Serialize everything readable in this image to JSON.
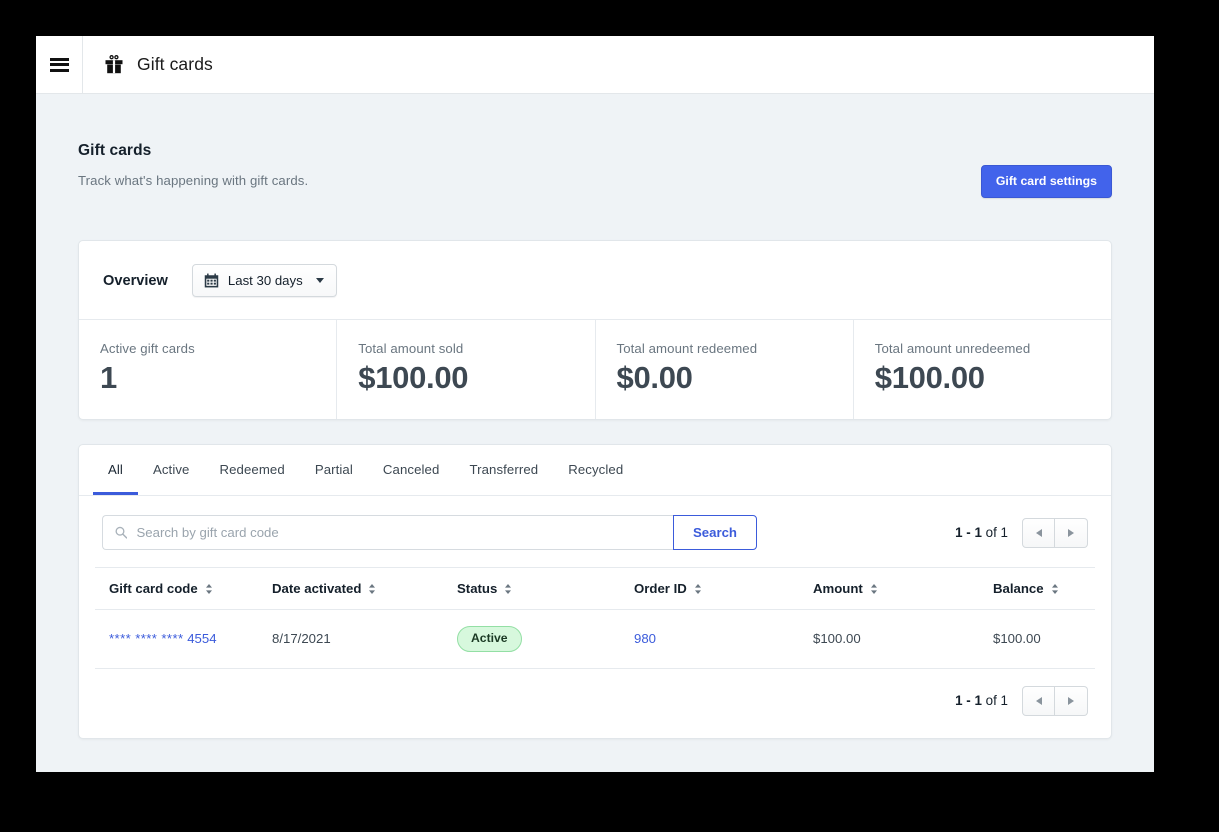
{
  "topbar": {
    "menu_icon": "hamburger-icon",
    "app_icon": "gift-icon",
    "title": "Gift cards"
  },
  "page": {
    "title": "Gift cards",
    "subtitle": "Track what's happening with gift cards.",
    "settings_button": "Gift card settings"
  },
  "overview": {
    "label": "Overview",
    "date_range": "Last 30 days",
    "metrics": [
      {
        "label": "Active gift cards",
        "value": "1"
      },
      {
        "label": "Total amount sold",
        "value": "$100.00"
      },
      {
        "label": "Total amount redeemed",
        "value": "$0.00"
      },
      {
        "label": "Total amount unredeemed",
        "value": "$100.00"
      }
    ]
  },
  "tabs": [
    {
      "label": "All",
      "active": true
    },
    {
      "label": "Active",
      "active": false
    },
    {
      "label": "Redeemed",
      "active": false
    },
    {
      "label": "Partial",
      "active": false
    },
    {
      "label": "Canceled",
      "active": false
    },
    {
      "label": "Transferred",
      "active": false
    },
    {
      "label": "Recycled",
      "active": false
    }
  ],
  "search": {
    "placeholder": "Search by gift card code",
    "value": "",
    "button_label": "Search"
  },
  "pagination": {
    "range": "1 - 1",
    "of_text": "of 1"
  },
  "table": {
    "columns": [
      "Gift card code",
      "Date activated",
      "Status",
      "Order ID",
      "Amount",
      "Balance"
    ],
    "rows": [
      {
        "code_mask": "**** **** ****",
        "code_last4": "4554",
        "date_activated": "8/17/2021",
        "status": "Active",
        "order_id": "980",
        "amount": "$100.00",
        "balance": "$100.00"
      }
    ]
  },
  "colors": {
    "accent_blue": "#3b5bdb",
    "primary_button": "#4263eb",
    "page_background": "#eff3f6",
    "badge_green_bg": "#d7f8dd",
    "badge_green_border": "#93dfa4"
  }
}
